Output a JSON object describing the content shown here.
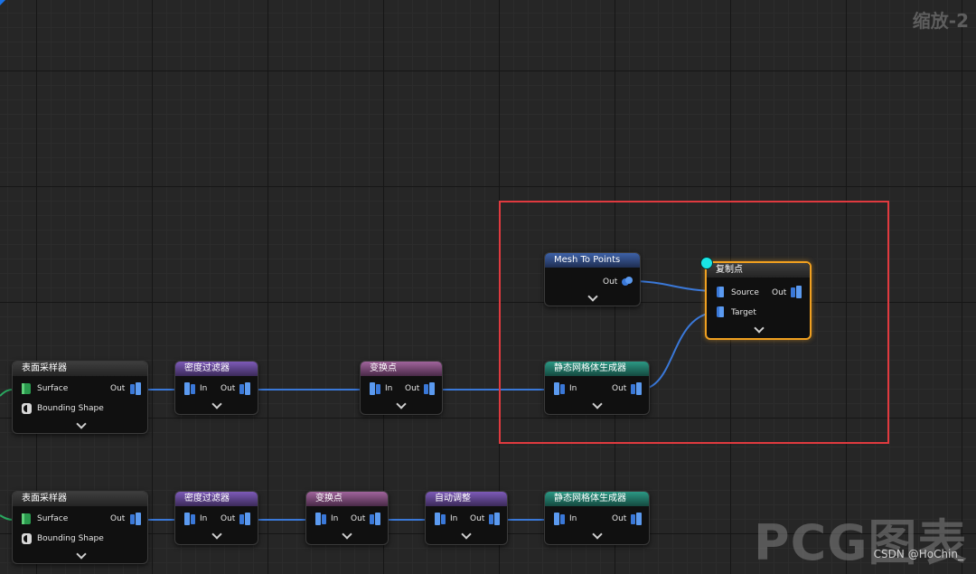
{
  "canvas": {
    "zoom_label": "缩放-2",
    "watermark": "PCG图表",
    "credit": "CSDN @HoChin_",
    "colors": {
      "background": "#262626",
      "wire": "#3a78d8",
      "wire_green": "#2aa860",
      "selection_box": "#e03a3f",
      "selected_node_border": "#f0a020",
      "focus_dot": "#19e6e6"
    }
  },
  "row1": {
    "surface_sampler": {
      "title": "表面采样器",
      "pin_surface": "Surface",
      "pin_bounding": "Bounding Shape",
      "out": "Out"
    },
    "density_filter": {
      "title": "密度过滤器",
      "in": "In",
      "out": "Out"
    },
    "transform_points": {
      "title": "变换点",
      "in": "In",
      "out": "Out"
    },
    "static_mesh_spawner": {
      "title": "静态网格体生成器",
      "in": "In",
      "out": "Out"
    }
  },
  "highlighted": {
    "mesh_to_points": {
      "title": "Mesh To Points",
      "out": "Out"
    },
    "copy_points": {
      "title": "复制点",
      "source": "Source",
      "target": "Target",
      "out": "Out"
    }
  },
  "row2": {
    "surface_sampler": {
      "title": "表面采样器",
      "pin_surface": "Surface",
      "pin_bounding": "Bounding Shape",
      "out": "Out"
    },
    "density_filter": {
      "title": "密度过滤器",
      "in": "In",
      "out": "Out"
    },
    "transform_points": {
      "title": "变换点",
      "in": "In",
      "out": "Out"
    },
    "self_pruning": {
      "title": "自动调整",
      "in": "In",
      "out": "Out"
    },
    "static_mesh_spawner": {
      "title": "静态网格体生成器",
      "in": "In",
      "out": "Out"
    }
  }
}
